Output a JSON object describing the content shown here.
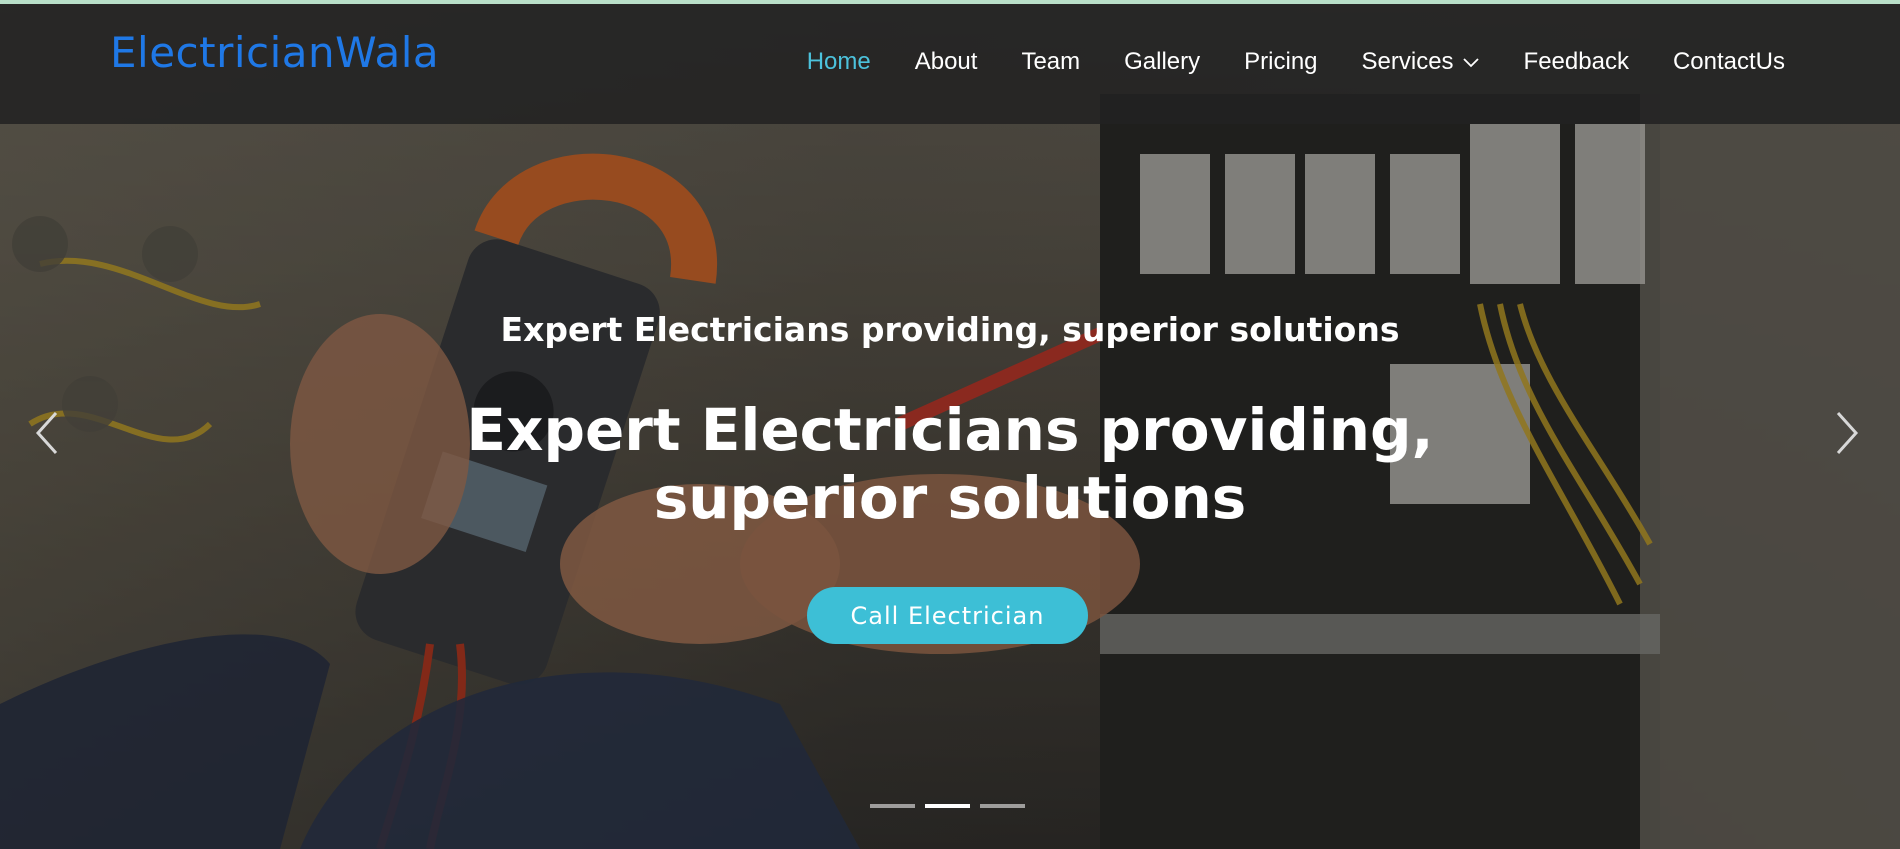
{
  "brand": {
    "name": "ElectricianWala"
  },
  "nav": {
    "items": [
      {
        "label": "Home",
        "active": true
      },
      {
        "label": "About"
      },
      {
        "label": "Team"
      },
      {
        "label": "Gallery"
      },
      {
        "label": "Pricing"
      },
      {
        "label": "Services",
        "has_dropdown": true,
        "icon": "chevron-down-icon"
      },
      {
        "label": "Feedback"
      },
      {
        "label": "ContactUs"
      }
    ]
  },
  "hero": {
    "subtitle": "Expert Electricians providing, superior solutions",
    "title_line1": "Expert Electricians providing,",
    "title_line2": "superior solutions",
    "cta_label": "Call Electrician",
    "prev_icon": "chevron-left-icon",
    "next_icon": "chevron-right-icon",
    "slides_total": 3,
    "active_slide": 2
  },
  "colors": {
    "brand": "#1f78e6",
    "nav_active": "#4cc2dc",
    "cta": "#3dbfd6",
    "nav_background": "#222222",
    "top_strip": "#b9dfc8"
  }
}
